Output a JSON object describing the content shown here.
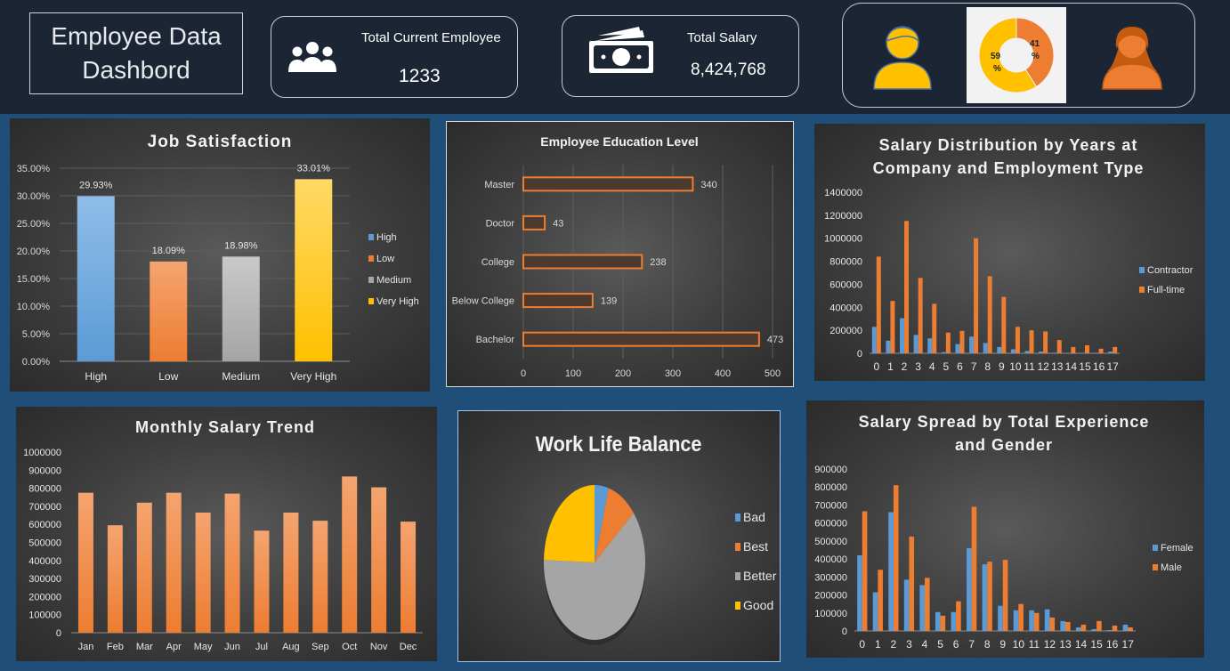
{
  "header": {
    "title_line1": "Employee Data",
    "title_line2": "Dashbord",
    "kpi_employees": {
      "label": "Total Current Employee",
      "value": "1233",
      "icon": "people-icon"
    },
    "kpi_salary": {
      "label": "Total Salary",
      "value": "8,424,768",
      "icon": "money-icon"
    },
    "gender": {
      "male_pct": "59",
      "female_pct": "41",
      "pct_sign": "%",
      "male_color": "#ffc000",
      "female_color": "#ed7d31"
    }
  },
  "chart_data": [
    {
      "id": "job_satisfaction",
      "type": "bar",
      "title": "Job Satisfaction",
      "categories": [
        "High",
        "Low",
        "Medium",
        "Very High"
      ],
      "values": [
        29.93,
        18.09,
        18.98,
        33.01
      ],
      "data_labels": [
        "29.93%",
        "18.09%",
        "18.98%",
        "33.01%"
      ],
      "colors": [
        "#5b9bd5",
        "#ed7d31",
        "#a5a5a5",
        "#ffc000"
      ],
      "ylim": [
        0,
        35
      ],
      "yticks": [
        "0.00%",
        "5.00%",
        "10.00%",
        "15.00%",
        "20.00%",
        "25.00%",
        "30.00%",
        "35.00%"
      ],
      "legend": [
        "High",
        "Low",
        "Medium",
        "Very High"
      ],
      "legend_position": "right",
      "grid": true
    },
    {
      "id": "education_level",
      "type": "bar",
      "orientation": "horizontal",
      "title": "Employee Education Level",
      "categories": [
        "Master",
        "Doctor",
        "College",
        "Below College",
        "Bachelor"
      ],
      "values": [
        340,
        43,
        238,
        139,
        473
      ],
      "data_labels": [
        "340",
        "43",
        "238",
        "139",
        "473"
      ],
      "xlim": [
        0,
        500
      ],
      "xticks": [
        "0",
        "100",
        "200",
        "300",
        "400",
        "500"
      ],
      "color": "#ed7d31",
      "grid": true
    },
    {
      "id": "salary_by_years",
      "type": "bar",
      "title_lines": [
        "Salary Distribution by Years at",
        "Company and Employment Type"
      ],
      "categories": [
        "0",
        "1",
        "2",
        "3",
        "4",
        "5",
        "6",
        "7",
        "8",
        "9",
        "10",
        "11",
        "12",
        "13",
        "14",
        "15",
        "16",
        "17"
      ],
      "series": [
        {
          "name": "Contractor",
          "color": "#5b9bd5",
          "values": [
            230000,
            110000,
            305000,
            160000,
            130000,
            10000,
            80000,
            145000,
            90000,
            55000,
            35000,
            20000,
            15000,
            5000,
            3000,
            3000,
            5000,
            15000
          ]
        },
        {
          "name": "Full-time",
          "color": "#ed7d31",
          "values": [
            840000,
            455000,
            1150000,
            655000,
            430000,
            180000,
            195000,
            1000000,
            670000,
            490000,
            230000,
            200000,
            190000,
            115000,
            55000,
            70000,
            40000,
            55000
          ]
        }
      ],
      "ylim": [
        0,
        1400000
      ],
      "yticks": [
        "0",
        "200000",
        "400000",
        "600000",
        "800000",
        "1000000",
        "1200000",
        "1400000"
      ],
      "legend_position": "right"
    },
    {
      "id": "monthly_salary",
      "type": "bar",
      "title": "Monthly Salary Trend",
      "categories": [
        "Jan",
        "Feb",
        "Mar",
        "Apr",
        "May",
        "Jun",
        "Jul",
        "Aug",
        "Sep",
        "Oct",
        "Nov",
        "Dec"
      ],
      "values": [
        775000,
        595000,
        720000,
        775000,
        665000,
        770000,
        565000,
        665000,
        620000,
        865000,
        805000,
        615000
      ],
      "color": "#ed7d31",
      "ylim": [
        0,
        1000000
      ],
      "yticks": [
        "0",
        "100000",
        "200000",
        "300000",
        "400000",
        "500000",
        "600000",
        "700000",
        "800000",
        "900000",
        "1000000"
      ]
    },
    {
      "id": "work_life_balance",
      "type": "pie",
      "title": "Work Life Balance",
      "categories": [
        "Bad",
        "Best",
        "Better",
        "Good"
      ],
      "values": [
        4.5,
        9.5,
        61.5,
        24.5
      ],
      "colors": [
        "#5b9bd5",
        "#ed7d31",
        "#a5a5a5",
        "#ffc000"
      ],
      "legend_position": "right"
    },
    {
      "id": "salary_by_experience_gender",
      "type": "bar",
      "title_lines": [
        "Salary Spread by Total Experience",
        "and Gender"
      ],
      "categories": [
        "0",
        "1",
        "2",
        "3",
        "4",
        "5",
        "6",
        "7",
        "8",
        "9",
        "10",
        "11",
        "12",
        "13",
        "14",
        "15",
        "16",
        "17"
      ],
      "series": [
        {
          "name": "Female",
          "color": "#5b9bd5",
          "values": [
            420000,
            215000,
            660000,
            285000,
            255000,
            105000,
            105000,
            460000,
            370000,
            140000,
            115000,
            115000,
            120000,
            55000,
            20000,
            10000,
            5000,
            35000
          ]
        },
        {
          "name": "Male",
          "color": "#ed7d31",
          "values": [
            665000,
            340000,
            810000,
            525000,
            295000,
            85000,
            165000,
            690000,
            385000,
            395000,
            150000,
            100000,
            75000,
            50000,
            35000,
            55000,
            30000,
            20000
          ]
        }
      ],
      "ylim": [
        0,
        900000
      ],
      "yticks": [
        "0",
        "100000",
        "200000",
        "300000",
        "400000",
        "500000",
        "600000",
        "700000",
        "800000",
        "900000"
      ],
      "legend_position": "right"
    }
  ]
}
